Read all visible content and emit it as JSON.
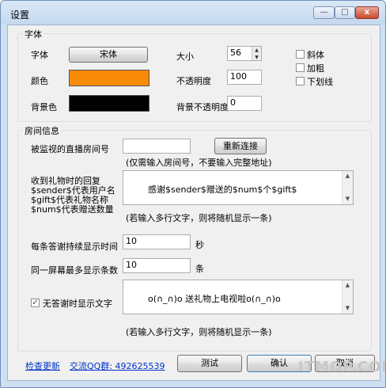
{
  "window": {
    "title": "设置",
    "controls": {
      "minimize": "—",
      "maximize": "□",
      "close": "x"
    }
  },
  "font_group": {
    "title": "字体",
    "font_label": "字体",
    "font_button": "宋体",
    "size_label": "大小",
    "size_value": "56",
    "color_label": "颜色",
    "color_hex": "#f78b07",
    "opacity_label": "不透明度",
    "opacity_value": "100",
    "bg_color_label": "背景色",
    "bg_color_hex": "#000000",
    "bg_opacity_label": "背景不透明度",
    "bg_opacity_value": "0",
    "italic_label": "斜体",
    "bold_label": "加粗",
    "underline_label": "下划线"
  },
  "room_group": {
    "title": "房间信息",
    "room_label": "被监视的直播房间号",
    "room_value": "",
    "reconnect_button": "重新连接",
    "room_hint": "(仅需输入房间号，不要输入完整地址)",
    "gift_reply_label_lines": [
      "收到礼物时的回复",
      "$sender$代表用户名",
      "$gift$代表礼物名称",
      "$num$代表赠送数量"
    ],
    "gift_reply_value": "感谢$sender$赠送的$num$个$gift$",
    "multiline_hint": "(若输入多行文字，则将随机显示一条)",
    "duration_label": "每条答谢持续显示时间",
    "duration_value": "10",
    "duration_unit": "秒",
    "max_label": "同一屏幕最多显示条数",
    "max_value": "10",
    "max_unit": "条",
    "idle_checkbox_label": "无答谢时显示文字",
    "idle_checked": true,
    "idle_check_glyph": "✓",
    "idle_text_value": "o(∩_∩)o 送礼物上电视啦o(∩_∩)o",
    "idle_hint": "(若输入多行文字，则将随机显示一条)"
  },
  "footer": {
    "check_update": "检查更新",
    "qq_group": "交流QQ群: 492625539",
    "test_button": "测试",
    "ok_button": "确认",
    "cancel_button": "取消"
  },
  "watermark": "ITMOP.COM"
}
